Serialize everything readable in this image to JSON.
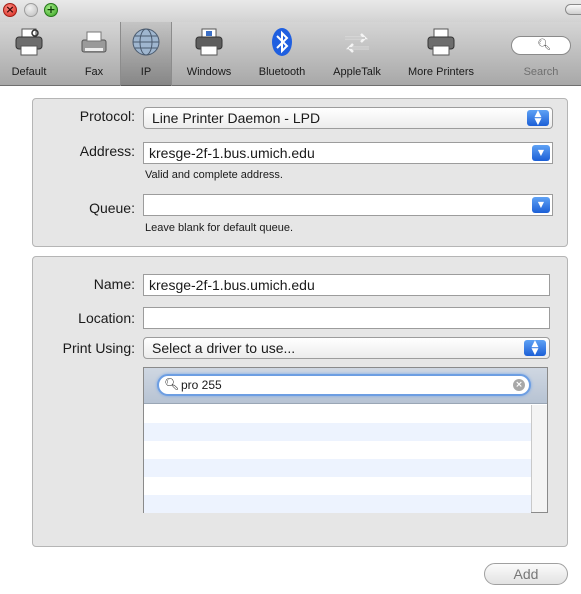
{
  "window": {
    "controls": [
      "close",
      "minimize",
      "zoom"
    ]
  },
  "toolbar": {
    "items": [
      {
        "label": "Default",
        "icon": "printer-default-icon"
      },
      {
        "label": "Fax",
        "icon": "fax-icon"
      },
      {
        "label": "IP",
        "icon": "globe-icon",
        "selected": true
      },
      {
        "label": "Windows",
        "icon": "printer-windows-icon"
      },
      {
        "label": "Bluetooth",
        "icon": "bluetooth-icon"
      },
      {
        "label": "AppleTalk",
        "icon": "appletalk-icon"
      },
      {
        "label": "More Printers",
        "icon": "printer-more-icon"
      },
      {
        "label": "Search",
        "icon": "search-icon"
      }
    ]
  },
  "connection": {
    "protocol_label": "Protocol:",
    "protocol_value": "Line Printer Daemon - LPD",
    "address_label": "Address:",
    "address_value": "kresge-2f-1.bus.umich.edu",
    "address_hint": "Valid and complete address.",
    "queue_label": "Queue:",
    "queue_value": "",
    "queue_hint": "Leave blank for default queue."
  },
  "printer": {
    "name_label": "Name:",
    "name_value": "kresge-2f-1.bus.umich.edu",
    "location_label": "Location:",
    "location_value": "",
    "print_using_label": "Print Using:",
    "print_using_value": "Select a driver to use...",
    "driver_search_value": "pro 255",
    "driver_list": []
  },
  "actions": {
    "add_label": "Add"
  },
  "colors": {
    "accent": "#2a6fe0",
    "list_alt_row": "#edf3fe",
    "panel": "#e6e6e6"
  }
}
